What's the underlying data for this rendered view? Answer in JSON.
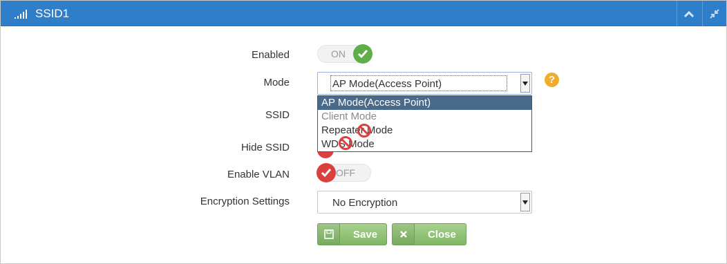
{
  "window": {
    "title": "SSID1",
    "accent": "#2f7ec9",
    "icons": [
      "signal-bars-icon",
      "chevron-up-icon",
      "compress-icon"
    ]
  },
  "form": {
    "enabled_label": "Enabled",
    "enabled_toggle": "ON",
    "mode_label": "Mode",
    "mode_value": "AP Mode(Access Point)",
    "mode_options": [
      "AP Mode(Access Point)",
      "Client Mode",
      "Repeater Mode",
      "WDS Mode"
    ],
    "ssid_label": "SSID",
    "hide_ssid_label": "Hide SSID",
    "enable_vlan_label": "Enable VLAN",
    "vlan_toggle": "OFF",
    "encryption_label": "Encryption Settings",
    "encryption_value": "No Encryption",
    "help_symbol": "?"
  },
  "buttons": {
    "save": "Save",
    "close": "Close"
  },
  "colors": {
    "on": "#5fae4a",
    "off": "#d9403e",
    "help": "#f0ad2b",
    "button": "#8cc173"
  }
}
